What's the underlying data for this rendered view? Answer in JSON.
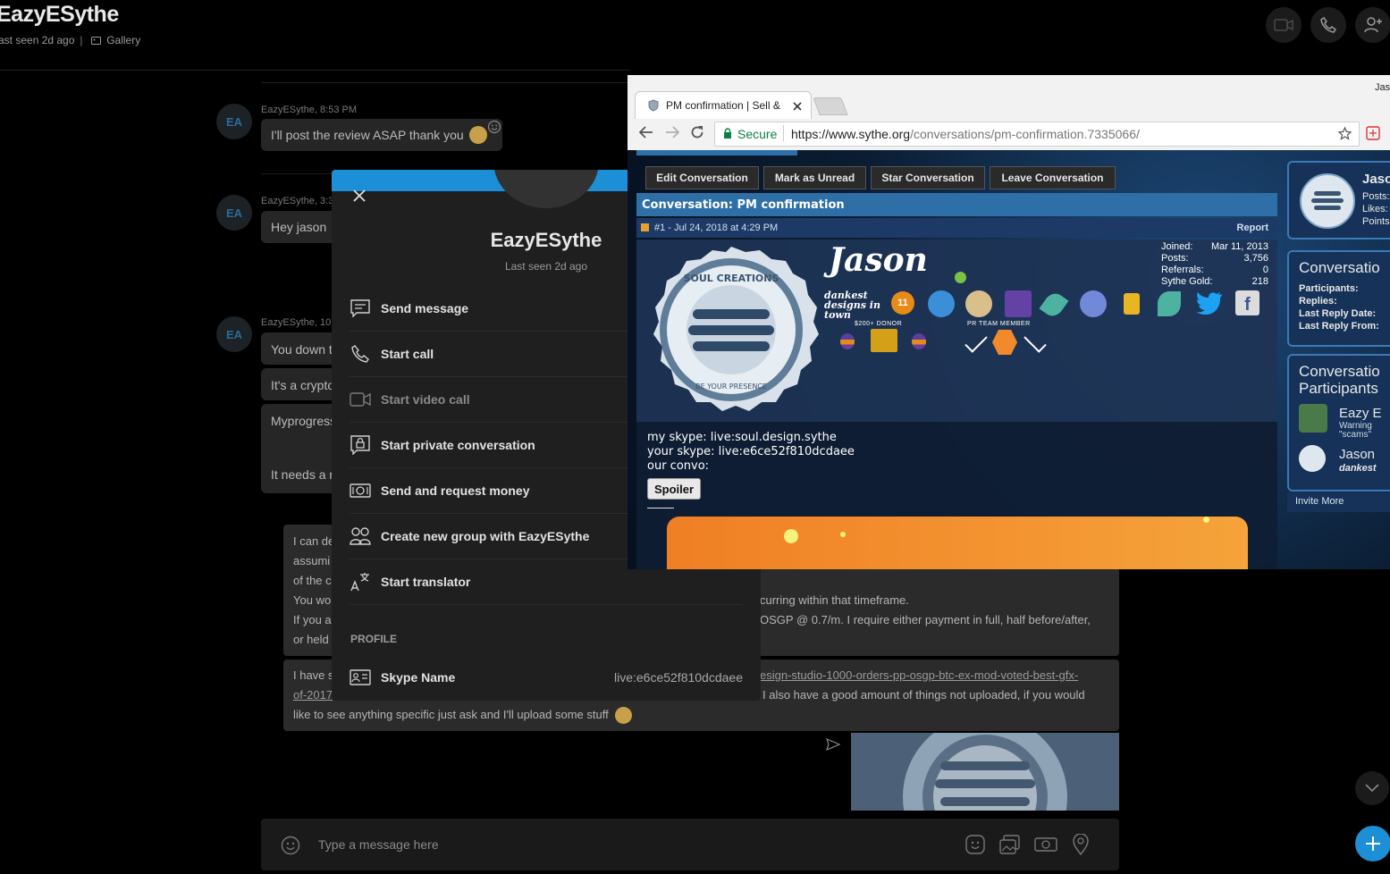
{
  "skype": {
    "contact_name": "EazyESythe",
    "last_seen": "ast seen 2d ago",
    "gallery": "Gallery",
    "messages": [
      {
        "initials": "EA",
        "meta": "EazyESythe, 8:53 PM",
        "text": "I'll post the review ASAP thank you"
      },
      {
        "initials": "EA",
        "meta": "EazyESythe, 3:3",
        "text": "Hey jason"
      },
      {
        "initials": "EA",
        "meta": "EazyESythe, 10:",
        "lines": [
          "You down t",
          "It's a crypto",
          "Myprogress",
          "It needs a r"
        ]
      }
    ],
    "own_message_1": {
      "lines": [
        "I can de",
        "assumi",
        "of the c",
        "You wo",
        "If you a",
        "or held"
      ],
      "tail_1": "curring within that timeframe.",
      "tail_2": "OSGP @ 0.7/m. I require either payment in full, half before/after,"
    },
    "own_message_2": {
      "prefix": "I have s",
      "link_1": "esign-studio-1000-orders-pp-osgp-btc-ex-mod-voted-best-gfx-",
      "link_2": "of-2017",
      "line_2_tail": "I also have a good amount of things not uploaded, if you would",
      "line_3": "like to see anything specific just ask and I'll upload some stuff"
    },
    "composer_placeholder": "Type a message here"
  },
  "profile_popup": {
    "name": "EazyESythe",
    "last_seen": "Last seen 2d ago",
    "actions": [
      {
        "label": "Send message",
        "icon": "message-icon"
      },
      {
        "label": "Start call",
        "icon": "phone-icon"
      },
      {
        "label": "Start video call",
        "icon": "video-icon"
      },
      {
        "label": "Start private conversation",
        "icon": "lock-chat-icon"
      },
      {
        "label": "Send and request money",
        "icon": "money-icon"
      },
      {
        "label": "Create new group with EazyESythe",
        "icon": "group-icon"
      },
      {
        "label": "Start translator",
        "icon": "translate-icon"
      }
    ],
    "profile_heading": "PROFILE",
    "skype_name_label": "Skype Name",
    "skype_name_value": "live:e6ce52f810dcdaee"
  },
  "browser": {
    "tab_title": "PM confirmation | Sell &",
    "secure_label": "Secure",
    "url_host": "https://www.sythe.org",
    "url_path": "/conversations/pm-confirmation.7335066/",
    "corner_text": "Jas",
    "buttons": [
      "Edit Conversation",
      "Mark as Unread",
      "Star Conversation",
      "Leave Conversation"
    ],
    "conversation_title": "Conversation: PM confirmation",
    "post_meta": "#1 - Jul 24, 2018 at 4:29 PM",
    "report": "Report",
    "signature_name": "Jason",
    "user_title": "dankest designs in town",
    "donor_label": "$200+ DONOR",
    "team_label": "PR TEAM MEMBER",
    "post_badge_number": "11",
    "logo_text_top": "SOUL CREATIONS",
    "logo_text_bottom": "BE YOUR PRESENCE",
    "stats": [
      {
        "label": "Joined:",
        "value": "Mar 11, 2013"
      },
      {
        "label": "Posts:",
        "value": "3,756"
      },
      {
        "label": "Referrals:",
        "value": "0"
      },
      {
        "label": "Sythe Gold:",
        "value": "218"
      }
    ],
    "body_lines": [
      "my skype: live:soul.design.sythe",
      "your skype: live:e6ce52f810dcdaee",
      "our convo:"
    ],
    "spoiler": "Spoiler",
    "sidebar": {
      "user_name": "Jaso",
      "user_stats": [
        "Posts:",
        "Likes:",
        "Points"
      ],
      "conv_title": "Conversatio",
      "conv_rows": [
        "Participants:",
        "Replies:",
        "Last Reply Date:",
        "Last Reply From:"
      ],
      "participants_title_1": "Conversatio",
      "participants_title_2": "Participants",
      "p1_name": "Eazy E",
      "p1_sub_1": "Warning",
      "p1_sub_2": "\"scams\"",
      "p2_name": "Jason",
      "p2_sub": "dankest",
      "invite": "Invite More"
    }
  },
  "colors": {
    "accent": "#1c8fd6",
    "background": "#000000",
    "sythe_bar": "#2e6fa8"
  }
}
